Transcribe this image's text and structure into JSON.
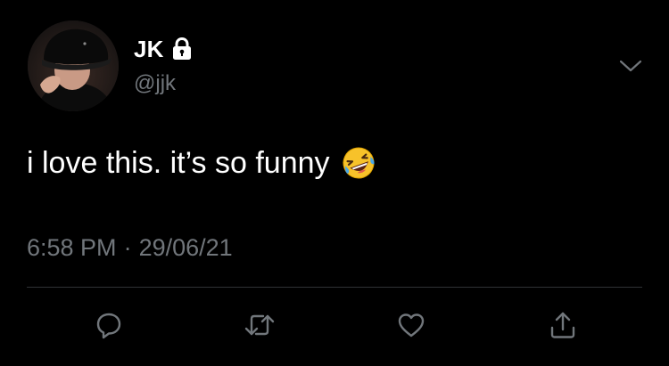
{
  "author": {
    "display_name": "JK",
    "handle": "@jjk",
    "protected_icon": "lock-icon",
    "avatar": "profile-photo"
  },
  "tweet": {
    "text": "i love this. it’s so funny",
    "emoji": "rolling-on-the-floor-laughing",
    "time": "6:58 PM",
    "separator": "·",
    "date": "29/06/21"
  },
  "actions": [
    {
      "name": "reply",
      "icon": "reply-icon"
    },
    {
      "name": "retweet",
      "icon": "retweet-icon"
    },
    {
      "name": "like",
      "icon": "heart-icon"
    },
    {
      "name": "share",
      "icon": "share-icon"
    }
  ],
  "colors": {
    "background": "#000000",
    "primary_text": "#ffffff",
    "secondary_text": "#71767b",
    "divider": "#2f3336",
    "icon": "#71767b"
  }
}
